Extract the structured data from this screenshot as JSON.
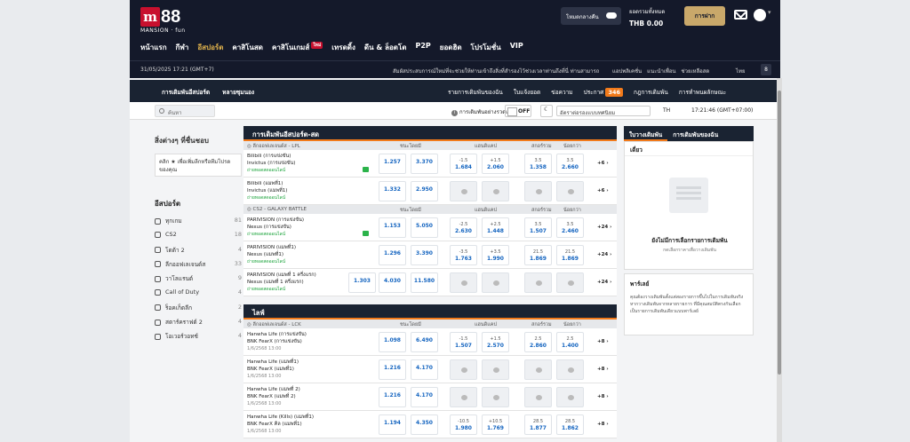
{
  "header": {
    "logo_mark": "m",
    "logo_num": "88",
    "logo_sub": "MANSION · fun",
    "mode_label": "โหมดกลางคืน",
    "balance_label": "ยอดรวมทั้งหมด",
    "balance_amount": "THB 0.00",
    "deposit_label": "การฝาก",
    "nav": [
      {
        "label": "หน้าแรก"
      },
      {
        "label": "กีฬา"
      },
      {
        "label": "อีสปอร์ต",
        "active": true
      },
      {
        "label": "คาสิโนสด"
      },
      {
        "label": "คาสิโนเกมส์",
        "badge": "ใหม่"
      },
      {
        "label": "เทรดดิ้ง"
      },
      {
        "label": "ดีน & ล็อตโต"
      },
      {
        "label": "P2P"
      },
      {
        "label": "ยอดฮิต"
      },
      {
        "label": "โปรโมชั่น"
      },
      {
        "label": "VIP"
      }
    ],
    "datetime": "31/05/2025 17:21 (GMT+7)",
    "ticker": "สัมผัสประสบการณ์ใหม่ที่จะช่วยให้ท่านเข้าถึงสิ่งที่สำรองไว้ช่วงเวลาท่านถึงที่นี่ ท่านสามารถ",
    "links": [
      "แอปพลิเคชั่น",
      "แนะนำเพื่อน",
      "ช่วยเหลือสด"
    ],
    "lang": "ไทย",
    "sq": "8"
  },
  "sportsbar": {
    "left": [
      "การเดิมพันอีสปอร์ต",
      "หลายซุมนอง"
    ],
    "right": [
      "รายการเดิมพันของฉัน",
      "ใบแจ้งยอด",
      "ข่อความ",
      "กฎการเดิมพัน",
      "การทำพนผลักษณะ"
    ],
    "promo_label": "ประกาศ",
    "promo_count": "346"
  },
  "filterbar": {
    "search_placeholder": "ค้นหา",
    "quick_label": "การเดิมพันอย่างรวดเร็ว",
    "off_label": "OFF",
    "odds_select": "อัตราต่อรองแบบทศนิยม",
    "lang_select": "TH",
    "clock": "17:21:46 (GMT+07:00)"
  },
  "left": {
    "fav_title": "สิ่งต่างๆ ที่ชื่นชอบ",
    "fav_hint": "คลิก ★ เพื่อเพิ่มลีกหรือทีมโปรดของคุณ",
    "esports_title": "อีสปอร์ต",
    "sports": [
      {
        "name": "ทุกเกม",
        "count": "81"
      },
      {
        "name": "CS2",
        "count": "18"
      },
      {
        "name": "โดต้า 2",
        "count": "4"
      },
      {
        "name": "ลีกออฟเลเจนด์ส",
        "count": "33"
      },
      {
        "name": "วาโลแรนต์",
        "count": "9"
      },
      {
        "name": "Call of Duty",
        "count": "4"
      },
      {
        "name": "ร็อคเก็ตลีก",
        "count": "2"
      },
      {
        "name": "สตาร์คราฟต์ 2",
        "count": "4"
      },
      {
        "name": "โอเวอร์วอทช์",
        "count": "4"
      }
    ]
  },
  "center": {
    "live_title": "การเดิมพันอีสปอร์ต-สด",
    "upcoming_title": "ไลฟ์",
    "col_1x2": "ชนะโดยมี",
    "col_hdp": "แฮนดิแคป",
    "col_ou": "สกอร์รวม",
    "col_ou2": "น้อยกว่า",
    "leagues": [
      {
        "name": "ลีกออฟเลเจนด์ส - LPL",
        "matches": [
          {
            "home": "Bilibili (การแข่งขัน)",
            "away": "Invictus (การแข่งขัน)",
            "meta": "ถ่ายทอดสดออนไลน์",
            "tv": true,
            "o1": "1.257",
            "o2": "3.370",
            "h1": "-1.5",
            "v1": "1.684",
            "h2": "+1.5",
            "v2": "2.060",
            "u1": "3.5",
            "w1": "1.358",
            "u2": "3.5",
            "w2": "2.660",
            "more": "+6"
          },
          {
            "home": "Bilibili (แมพที่1)",
            "away": "Invictus (แมพที่1)",
            "meta": "ถ่ายทอดสดออนไลน์",
            "o1": "1.332",
            "o2": "2.950",
            "lock": true,
            "more": "+6"
          }
        ]
      },
      {
        "name": "CS2 - GALAXY BATTLE",
        "matches": [
          {
            "home": "PARIVISION (การแข่งขัน)",
            "away": "Nexus (การแข่งขัน)",
            "meta": "ถ่ายทอดสดออนไลน์",
            "tv": true,
            "o1": "1.153",
            "o2": "5.050",
            "h1": "-2.5",
            "v1": "2.630",
            "h2": "+2.5",
            "v2": "1.448",
            "u1": "3.5",
            "w1": "1.507",
            "u2": "3.5",
            "w2": "2.460",
            "more": "+24"
          },
          {
            "home": "PARIVISION (แมพที่1)",
            "away": "Nexus (แมพที่1)",
            "meta": "ถ่ายทอดสดออนไลน์",
            "o1": "1.296",
            "o2": "3.390",
            "h1": "-3.5",
            "v1": "1.763",
            "h2": "+3.5",
            "v2": "1.990",
            "u1": "21.5",
            "w1": "1.869",
            "u2": "21.5",
            "w2": "1.869",
            "more": "+24"
          },
          {
            "home": "PARIVISION (แมพที่ 1 ครึ่งแรก)",
            "away": "Nexus (แมพที่ 1 ครึ่งแรก)",
            "meta": "ถ่ายทอดสดออนไลน์",
            "o0": "1.303",
            "o1": "4.030",
            "o2": "11.580",
            "lock": true,
            "more": "+24"
          }
        ]
      }
    ],
    "upcoming": {
      "name": "ลีกออฟเลเจนด์ส - LCK",
      "matches": [
        {
          "home": "Hanwha Life (การแข่งขัน)",
          "away": "BNK FearX (การแข่งขัน)",
          "meta": "1/6/2568 13:00",
          "o1": "1.098",
          "o2": "6.490",
          "h1": "-1.5",
          "v1": "1.507",
          "h2": "+1.5",
          "v2": "2.570",
          "u1": "2.5",
          "w1": "2.860",
          "u2": "2.5",
          "w2": "1.400",
          "more": "+8"
        },
        {
          "home": "Hanwha Life (แมพที่1)",
          "away": "BNK FearX (แมพที่1)",
          "meta": "1/6/2568 13:00",
          "o1": "1.216",
          "o2": "4.170",
          "lock": true,
          "more": "+8"
        },
        {
          "home": "Hanwha Life (แมพที่ 2)",
          "away": "BNK FearX (แมพที่ 2)",
          "meta": "1/6/2568 13:00",
          "o1": "1.216",
          "o2": "4.170",
          "lock": true,
          "more": "+8"
        },
        {
          "home": "Hanwha Life (Kills) (แมพที่1)",
          "away": "BNK FearX คิล (แมพที่1)",
          "meta": "1/6/2568 13:00",
          "o1": "1.194",
          "o2": "4.350",
          "h1": "-10.5",
          "v1": "1.980",
          "h2": "+10.5",
          "v2": "1.769",
          "u1": "28.5",
          "w1": "1.877",
          "u2": "28.5",
          "w2": "1.862",
          "more": "+8"
        }
      ]
    }
  },
  "right": {
    "tab1": "ใบวางเดิมพัน",
    "tab2": "การเดิมพันของฉัน",
    "single": "เดี่ยว",
    "empty": "ยังไม่มีการเลือกรายการเดิมพัน",
    "empty_sub": "กดเลือกราคาเพื่อวางเดิมพัน",
    "parlay_title": "พาร์เลย์",
    "parlay_desc": "คุณต้องวางเดิมพันตั้งแต่สองรายการขึ้นไปในการเดิมพันจริง หากวางเดิมพันจากหลายรายการ ที่มีคุณสมบัติตรงกันเลือกเป็นรายการเดิมพันเดียวแบบพาร์เลย์"
  }
}
